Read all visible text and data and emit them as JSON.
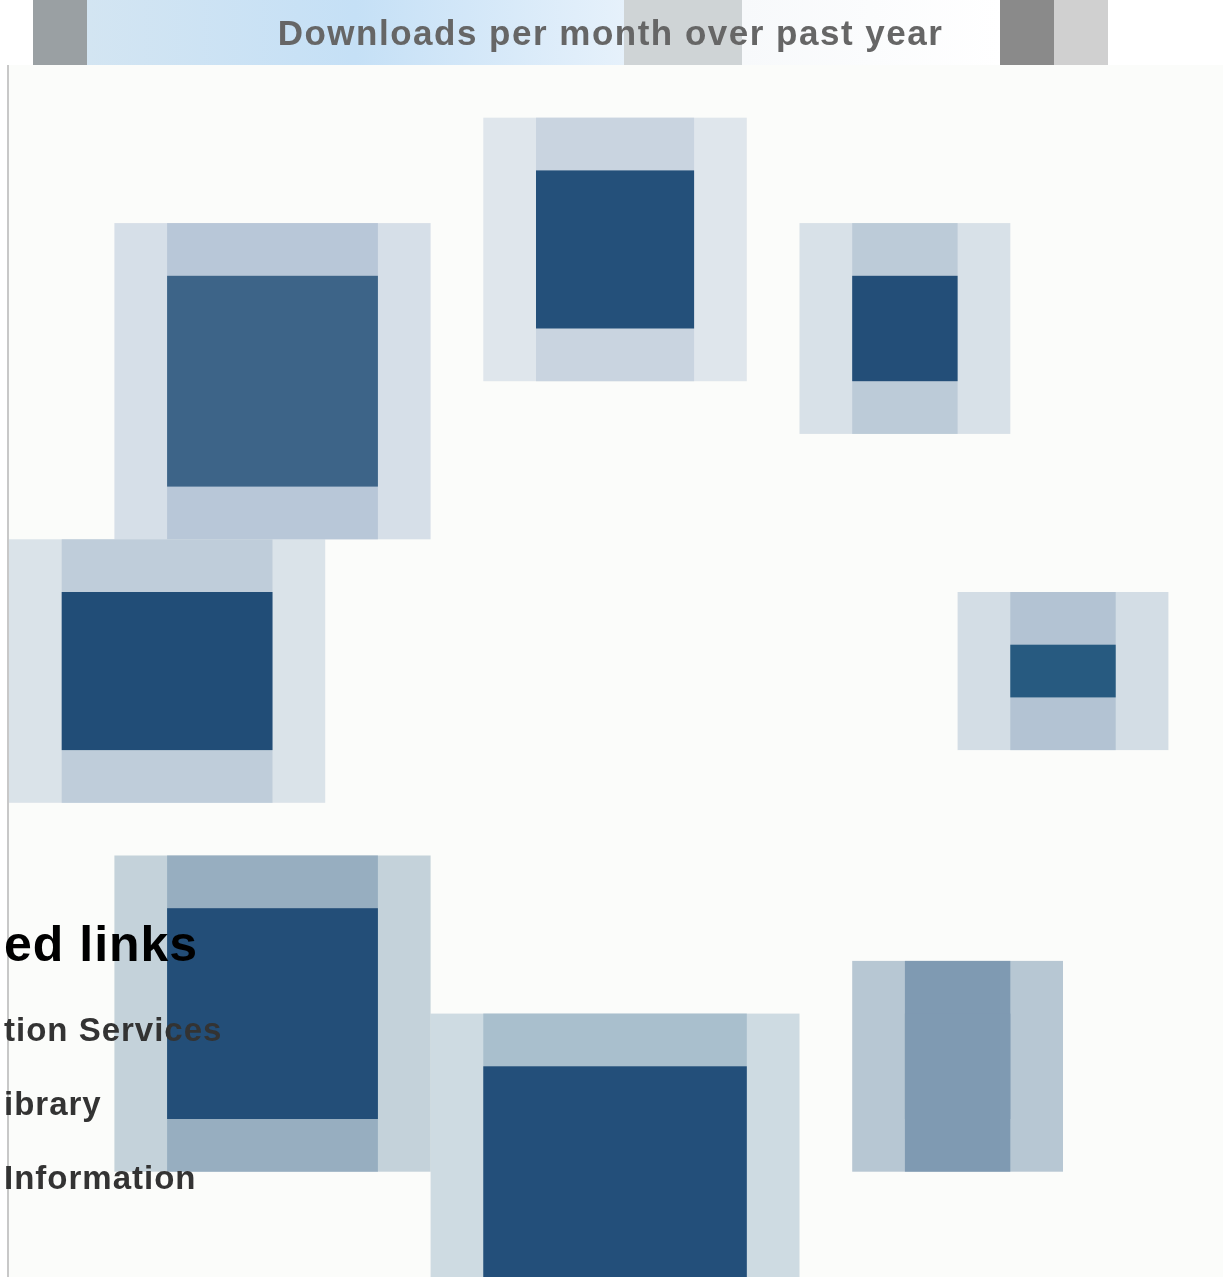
{
  "chart_title": "Downloads per month over past year",
  "related_links": {
    "heading": "ed links",
    "items": [
      "tion Services",
      "ibrary",
      "Information"
    ]
  }
}
